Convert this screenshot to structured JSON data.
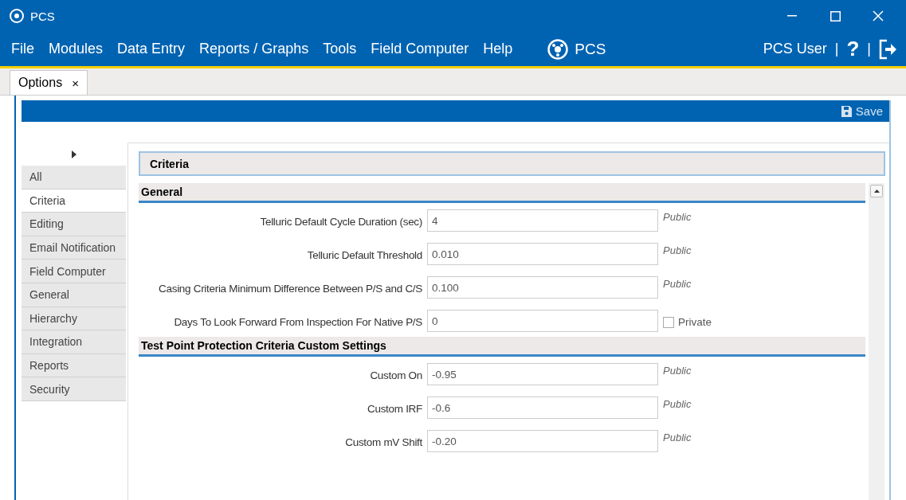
{
  "window": {
    "title": "PCS"
  },
  "menu": [
    "File",
    "Modules",
    "Data Entry",
    "Reports / Graphs",
    "Tools",
    "Field Computer",
    "Help"
  ],
  "brand": "PCS",
  "user": {
    "name": "PCS User",
    "separator": "|",
    "help": "?",
    "separator_2": "|"
  },
  "tabs": [
    {
      "label": "Options",
      "close": "×",
      "selected": true
    }
  ],
  "toolbar": {
    "save": "Save"
  },
  "sidebar": {
    "items": [
      {
        "label": "All",
        "selected": false
      },
      {
        "label": "Criteria",
        "selected": true
      },
      {
        "label": "Editing",
        "selected": false
      },
      {
        "label": "Email Notification",
        "selected": false
      },
      {
        "label": "Field Computer",
        "selected": false
      },
      {
        "label": "General",
        "selected": false
      },
      {
        "label": "Hierarchy",
        "selected": false
      },
      {
        "label": "Integration",
        "selected": false
      },
      {
        "label": "Reports",
        "selected": false
      },
      {
        "label": "Security",
        "selected": false
      }
    ]
  },
  "panel": {
    "title": "Criteria",
    "sections": [
      {
        "title": "General",
        "fields": [
          {
            "label": "Telluric Default Cycle Duration (sec)",
            "value": "4",
            "access": {
              "kind": "text",
              "text": "Public"
            }
          },
          {
            "label": "Telluric Default Threshold",
            "value": "0.010",
            "access": {
              "kind": "text",
              "text": "Public"
            }
          },
          {
            "label": "Casing Criteria Minimum Difference Between P/S and C/S",
            "value": "0.100",
            "access": {
              "kind": "text",
              "text": "Public"
            }
          },
          {
            "label": "Days To Look Forward From Inspection For Native P/S",
            "value": "0",
            "access": {
              "kind": "checkbox",
              "text": "Private",
              "checked": false
            }
          }
        ]
      },
      {
        "title": "Test Point Protection Criteria Custom Settings",
        "fields": [
          {
            "label": "Custom On",
            "value": "-0.95",
            "access": {
              "kind": "text",
              "text": "Public"
            }
          },
          {
            "label": "Custom IRF",
            "value": "-0.6",
            "access": {
              "kind": "text",
              "text": "Public"
            }
          },
          {
            "label": "Custom mV Shift",
            "value": "-0.20",
            "access": {
              "kind": "text",
              "text": "Public"
            }
          }
        ]
      }
    ]
  }
}
